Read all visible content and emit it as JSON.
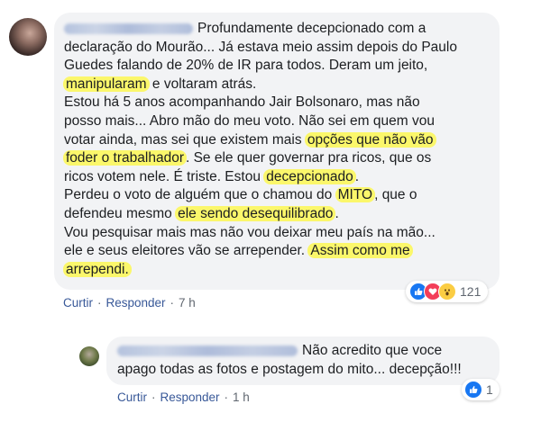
{
  "main_comment": {
    "lines": [
      [
        "Profundamente decepcionado com a"
      ],
      [
        "declaração do Mourão... Já estava meio assim depois do Paulo"
      ],
      [
        "Guedes falando de 20% de IR para todos. Deram um jeito,"
      ],
      [
        {
          "hl": "manipularam"
        },
        " e voltaram atrás."
      ],
      [
        "Estou há 5 anos acompanhando Jair Bolsonaro, mas não"
      ],
      [
        "posso mais... Abro mão do meu voto. Não sei em quem vou"
      ],
      [
        "votar ainda, mas sei que existem mais ",
        {
          "hl": "opções que não vão"
        }
      ],
      [
        {
          "hl": "foder o trabalhador"
        },
        ". Se ele quer governar pra ricos, que os"
      ],
      [
        "ricos votem nele. É triste. Estou ",
        {
          "hl": "decepcionado"
        },
        "."
      ],
      [
        "Perdeu o voto de alguém que o chamou do ",
        {
          "hl": "MITO"
        },
        ", que o"
      ],
      [
        "defendeu mesmo ",
        {
          "hl": "ele sendo desequilibrado"
        },
        "."
      ],
      [
        "Vou pesquisar mais mas não vou deixar meu país na mão..."
      ],
      [
        "ele e seus eleitores vão se arrepender. ",
        {
          "hl": "Assim como me"
        }
      ],
      [
        {
          "hl": "arrependi."
        }
      ]
    ],
    "actions": {
      "like": "Curtir",
      "reply": "Responder",
      "time": "7 h"
    },
    "reactions": {
      "icons": [
        "like",
        "love",
        "wow"
      ],
      "count": "121"
    }
  },
  "reply_comment": {
    "lines": [
      [
        "Não acredito que voce"
      ],
      [
        "apago todas as fotos e postagem do mito... decepção!!!"
      ]
    ],
    "actions": {
      "like": "Curtir",
      "reply": "Responder",
      "time": "1 h"
    },
    "reactions": {
      "icons": [
        "like"
      ],
      "count": "1"
    }
  },
  "colors": {
    "highlight": "#fbf76b",
    "bubble": "#f2f3f5",
    "link": "#385898",
    "like": "#1877f2",
    "love": "#f33e58",
    "wow": "#fbcd43"
  }
}
